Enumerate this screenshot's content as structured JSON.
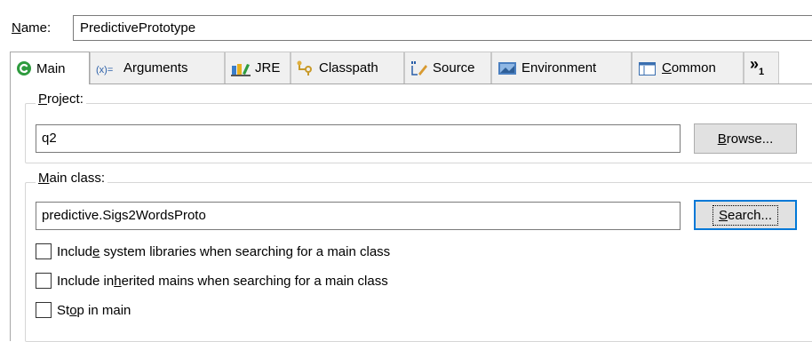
{
  "name": {
    "label_pre": "",
    "label_u": "N",
    "label_post": "ame:",
    "value": "PredictivePrototype"
  },
  "tabs": [
    {
      "id": "main",
      "label": "Main",
      "icon": "green-circle-c-icon",
      "active": true
    },
    {
      "id": "arguments",
      "label": "Arguments",
      "icon": "x-equals-arguments-icon"
    },
    {
      "id": "jre",
      "label": "JRE",
      "icon": "library-books-icon"
    },
    {
      "id": "classpath",
      "label": "Classpath",
      "icon": "classpath-icon"
    },
    {
      "id": "source",
      "label": "Source",
      "icon": "source-pencil-icon"
    },
    {
      "id": "environment",
      "label": "Environment",
      "icon": "environment-icon"
    },
    {
      "id": "common",
      "label_u": "C",
      "label_post": "ommon",
      "icon": "window-icon"
    },
    {
      "id": "overflow",
      "label": "»",
      "sub": "1"
    }
  ],
  "project": {
    "title_u": "P",
    "title_post": "roject:",
    "value": "q2",
    "browse_u": "B",
    "browse_post": "rowse..."
  },
  "main_class": {
    "title_u": "M",
    "title_post": "ain class:",
    "value": "predictive.Sigs2WordsProto",
    "search_u": "S",
    "search_post": "earch..."
  },
  "options": [
    {
      "pre": "Includ",
      "u": "e",
      "post": " system libraries when searching for a main class",
      "checked": false
    },
    {
      "pre": "Include in",
      "u": "h",
      "post": "erited mains when searching for a main class",
      "checked": false
    },
    {
      "pre": "St",
      "u": "o",
      "post": "p in main",
      "checked": false
    }
  ],
  "colors": {
    "accent": "#0078d7",
    "tab_bg": "#f0f0f0",
    "button_bg": "#e1e1e1"
  }
}
